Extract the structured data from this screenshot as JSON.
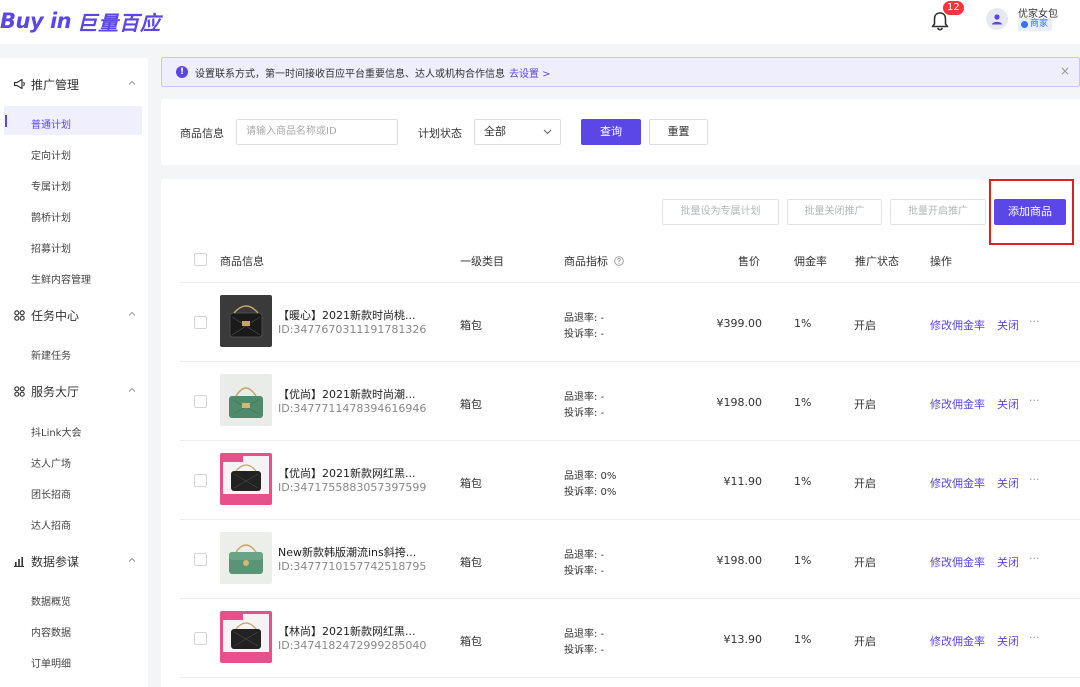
{
  "header": {
    "logo_latin": "Buy in",
    "logo_cn": "巨量百应",
    "notification_count": "12",
    "user_name": "优家女包",
    "user_tag": "商家"
  },
  "sidebar": {
    "groups": [
      {
        "label": "推广管理",
        "icon": "megaphone-icon",
        "items": [
          "普通计划",
          "定向计划",
          "专属计划",
          "鹊桥计划",
          "招募计划",
          "生鲜内容管理"
        ]
      },
      {
        "label": "任务中心",
        "icon": "grid-icon",
        "items": [
          "新建任务"
        ]
      },
      {
        "label": "服务大厅",
        "icon": "grid-icon",
        "items": [
          "抖Link大会",
          "达人广场",
          "团长招商",
          "达人招商"
        ]
      },
      {
        "label": "数据参谋",
        "icon": "bar-chart-icon",
        "items": [
          "数据概览",
          "内容数据",
          "订单明细"
        ]
      }
    ],
    "active_item": "普通计划"
  },
  "notice": {
    "text": "设置联系方式，第一时间接收百应平台重要信息、达人或机构合作信息",
    "link": "去设置 >",
    "close": "×"
  },
  "filter": {
    "product_label": "商品信息",
    "product_placeholder": "请输入商品名称或ID",
    "status_label": "计划状态",
    "status_value": "全部",
    "query_button": "查询",
    "reset_button": "重置"
  },
  "toolbar": {
    "batch_exclusive": "批量设为专属计划",
    "batch_close": "批量关闭推广",
    "batch_open": "批量开启推广",
    "add_product": "添加商品"
  },
  "table": {
    "columns": [
      "商品信息",
      "一级类目",
      "商品指标",
      "售价",
      "佣金率",
      "推广状态",
      "操作"
    ],
    "rows": [
      {
        "name": "【暖心】2021新款时尚桃...",
        "id": "ID:3477670311191781326",
        "category": "箱包",
        "return_rate": "品退率: -",
        "complaint_rate": "投诉率: -",
        "price": "¥399.00",
        "commission": "1%",
        "status": "开启",
        "op_edit": "修改佣金率",
        "op_close": "关闭",
        "op_more": "···",
        "thumb": "dark"
      },
      {
        "name": "【优尚】2021新款时尚潮...",
        "id": "ID:3477711478394616946",
        "category": "箱包",
        "return_rate": "品退率: -",
        "complaint_rate": "投诉率: -",
        "price": "¥198.00",
        "commission": "1%",
        "status": "开启",
        "op_edit": "修改佣金率",
        "op_close": "关闭",
        "op_more": "···",
        "thumb": "green"
      },
      {
        "name": "【优尚】2021新款网红黑...",
        "id": "ID:3471755883057397599",
        "category": "箱包",
        "return_rate": "品退率: 0%",
        "complaint_rate": "投诉率: 0%",
        "price": "¥11.90",
        "commission": "1%",
        "status": "开启",
        "op_edit": "修改佣金率",
        "op_close": "关闭",
        "op_more": "···",
        "thumb": "pink"
      },
      {
        "name": "New新款韩版潮流ins斜挎...",
        "id": "ID:3477710157742518795",
        "category": "箱包",
        "return_rate": "品退率: -",
        "complaint_rate": "投诉率: -",
        "price": "¥198.00",
        "commission": "1%",
        "status": "开启",
        "op_edit": "修改佣金率",
        "op_close": "关闭",
        "op_more": "···",
        "thumb": "green"
      },
      {
        "name": "【林尚】2021新款网红黑...",
        "id": "ID:3474182472999285040",
        "category": "箱包",
        "return_rate": "品退率: -",
        "complaint_rate": "投诉率: -",
        "price": "¥13.90",
        "commission": "1%",
        "status": "开启",
        "op_edit": "修改佣金率",
        "op_close": "关闭",
        "op_more": "···",
        "thumb": "pink"
      }
    ]
  },
  "colors": {
    "brand": "#5b47e8",
    "highlight": "#e02020",
    "badge": "#f5353d"
  }
}
